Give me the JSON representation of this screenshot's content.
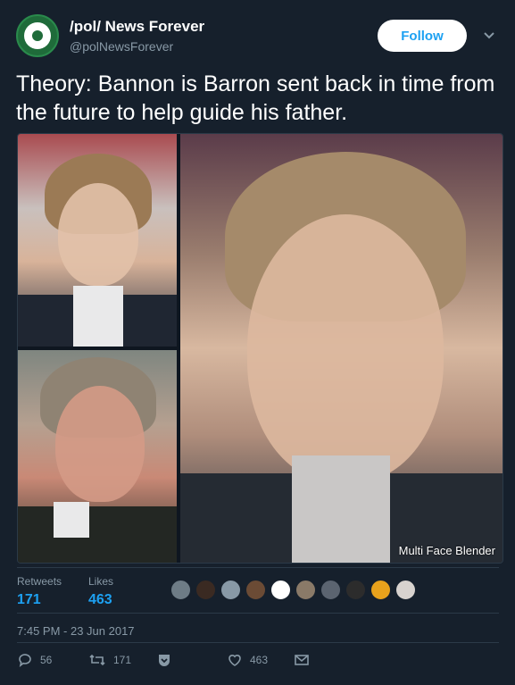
{
  "header": {
    "name": "/pol/ News Forever",
    "handle": "@polNewsForever",
    "follow_label": "Follow"
  },
  "tweet": {
    "text": "Theory: Bannon is Barron sent back in time from the future to help guide his father."
  },
  "media": {
    "watermark": "Multi Face Blender"
  },
  "stats": {
    "retweets_label": "Retweets",
    "retweets_value": "171",
    "likes_label": "Likes",
    "likes_value": "463"
  },
  "timestamp": "7:45 PM - 23 Jun 2017",
  "actions": {
    "replies": "56",
    "retweets": "171",
    "likes": "463"
  },
  "colors": {
    "background": "#16202c",
    "accent": "#1da1f2",
    "muted": "#8899a6"
  }
}
